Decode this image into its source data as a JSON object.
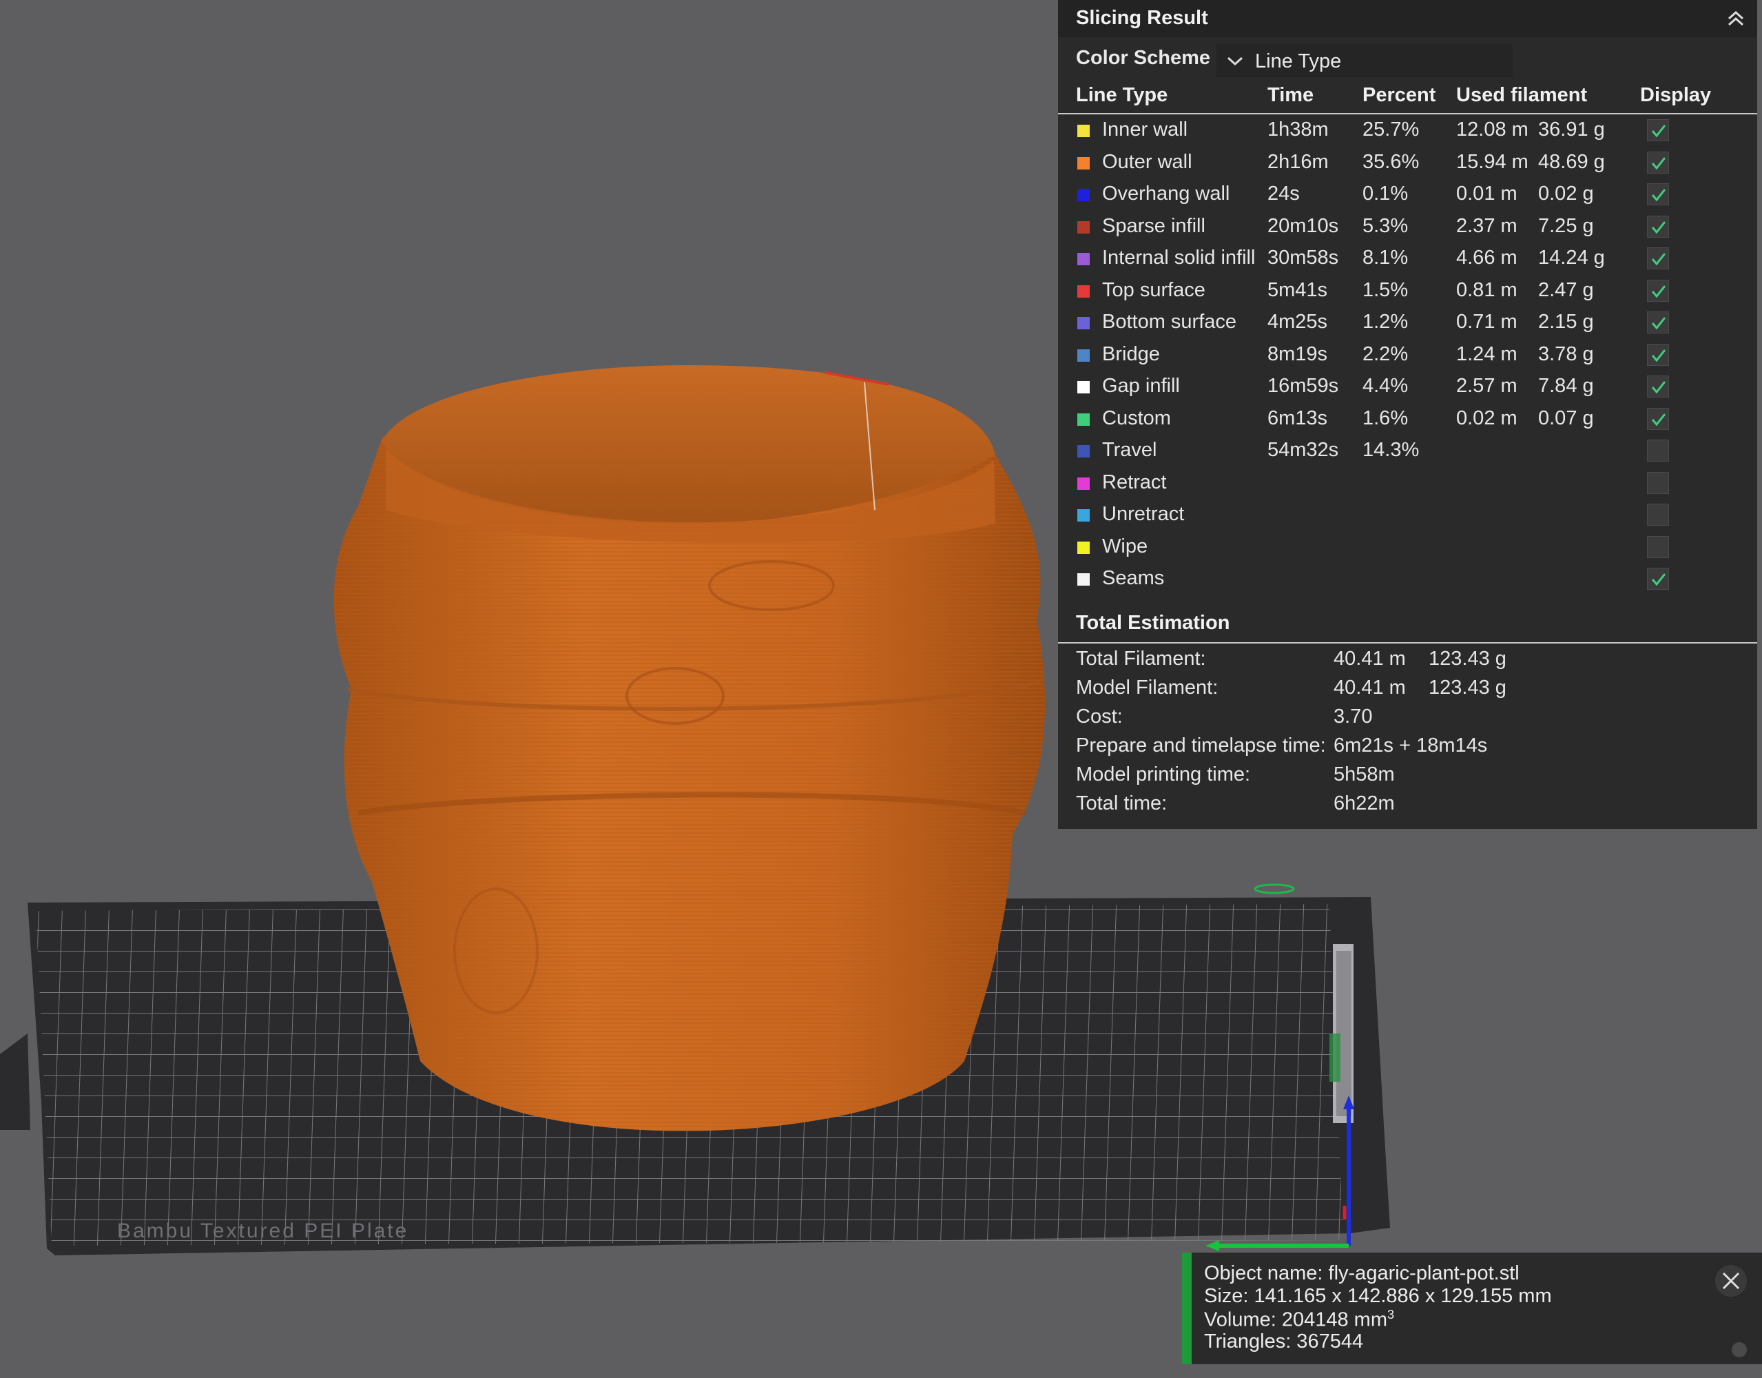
{
  "panel": {
    "title": "Slicing Result",
    "color_scheme_label": "Color Scheme",
    "color_scheme_value": "Line Type",
    "columns": [
      "Line Type",
      "Time",
      "Percent",
      "Used filament",
      "Display"
    ],
    "rows": [
      {
        "name": "Inner wall",
        "color": "#f5e33b",
        "time": "1h38m",
        "percent": "25.7%",
        "length": "12.08 m",
        "weight": "36.91 g",
        "display": true
      },
      {
        "name": "Outer wall",
        "color": "#f5822a",
        "time": "2h16m",
        "percent": "35.6%",
        "length": "15.94 m",
        "weight": "48.69 g",
        "display": true
      },
      {
        "name": "Overhang wall",
        "color": "#1f1fe0",
        "time": "24s",
        "percent": "0.1%",
        "length": "0.01 m",
        "weight": "0.02 g",
        "display": true
      },
      {
        "name": "Sparse infill",
        "color": "#b33a2a",
        "time": "20m10s",
        "percent": "5.3%",
        "length": "2.37 m",
        "weight": "7.25 g",
        "display": true
      },
      {
        "name": "Internal solid infill",
        "color": "#9c5ad6",
        "time": "30m58s",
        "percent": "8.1%",
        "length": "4.66 m",
        "weight": "14.24 g",
        "display": true
      },
      {
        "name": "Top surface",
        "color": "#e63a3a",
        "time": "5m41s",
        "percent": "1.5%",
        "length": "0.81 m",
        "weight": "2.47 g",
        "display": true
      },
      {
        "name": "Bottom surface",
        "color": "#6b62d8",
        "time": "4m25s",
        "percent": "1.2%",
        "length": "0.71 m",
        "weight": "2.15 g",
        "display": true
      },
      {
        "name": "Bridge",
        "color": "#4d86c8",
        "time": "8m19s",
        "percent": "2.2%",
        "length": "1.24 m",
        "weight": "3.78 g",
        "display": true
      },
      {
        "name": "Gap infill",
        "color": "#ffffff",
        "time": "16m59s",
        "percent": "4.4%",
        "length": "2.57 m",
        "weight": "7.84 g",
        "display": true
      },
      {
        "name": "Custom",
        "color": "#3fcf7a",
        "time": "6m13s",
        "percent": "1.6%",
        "length": "0.02 m",
        "weight": "0.07 g",
        "display": true
      },
      {
        "name": "Travel",
        "color": "#3d56b5",
        "time": "54m32s",
        "percent": "14.3%",
        "length": "",
        "weight": "",
        "display": false
      },
      {
        "name": "Retract",
        "color": "#e43ad6",
        "time": "",
        "percent": "",
        "length": "",
        "weight": "",
        "display": false
      },
      {
        "name": "Unretract",
        "color": "#3aa6e0",
        "time": "",
        "percent": "",
        "length": "",
        "weight": "",
        "display": false
      },
      {
        "name": "Wipe",
        "color": "#f2f21e",
        "time": "",
        "percent": "",
        "length": "",
        "weight": "",
        "display": false
      },
      {
        "name": "Seams",
        "color": "#f4f4f4",
        "time": "",
        "percent": "",
        "length": "",
        "weight": "",
        "display": true
      }
    ],
    "estimation_title": "Total Estimation",
    "estimation": [
      {
        "label": "Total Filament:",
        "value1": "40.41 m",
        "value2": "123.43 g"
      },
      {
        "label": "Model Filament:",
        "value1": "40.41 m",
        "value2": "123.43 g"
      },
      {
        "label": "Cost:",
        "value1": "3.70",
        "value2": ""
      },
      {
        "label": "Prepare and timelapse time:",
        "value1": "6m21s + 18m14s",
        "value2": ""
      },
      {
        "label": "Model printing time:",
        "value1": "5h58m",
        "value2": ""
      },
      {
        "label": "Total time:",
        "value1": "6h22m",
        "value2": ""
      }
    ]
  },
  "object_info": {
    "name": "Object name: fly-agaric-plant-pot.stl",
    "size": "Size: 141.165 x 142.886 x 129.155 mm",
    "volume_prefix": "Volume: 204148 mm",
    "volume_sup": "3",
    "triangles": "Triangles: 367544"
  },
  "plate_label": "Bambu Textured PEI Plate",
  "icons": {
    "collapse": "chevron-double-up-icon",
    "dropdown": "chevron-down-icon",
    "check": "check-icon",
    "close": "close-icon"
  },
  "colors": {
    "background": "#5e5e61",
    "panel": "#2a2a2b",
    "model": "#c8661f",
    "check": "#3fcf7a",
    "accent": "#1f9a3a"
  }
}
